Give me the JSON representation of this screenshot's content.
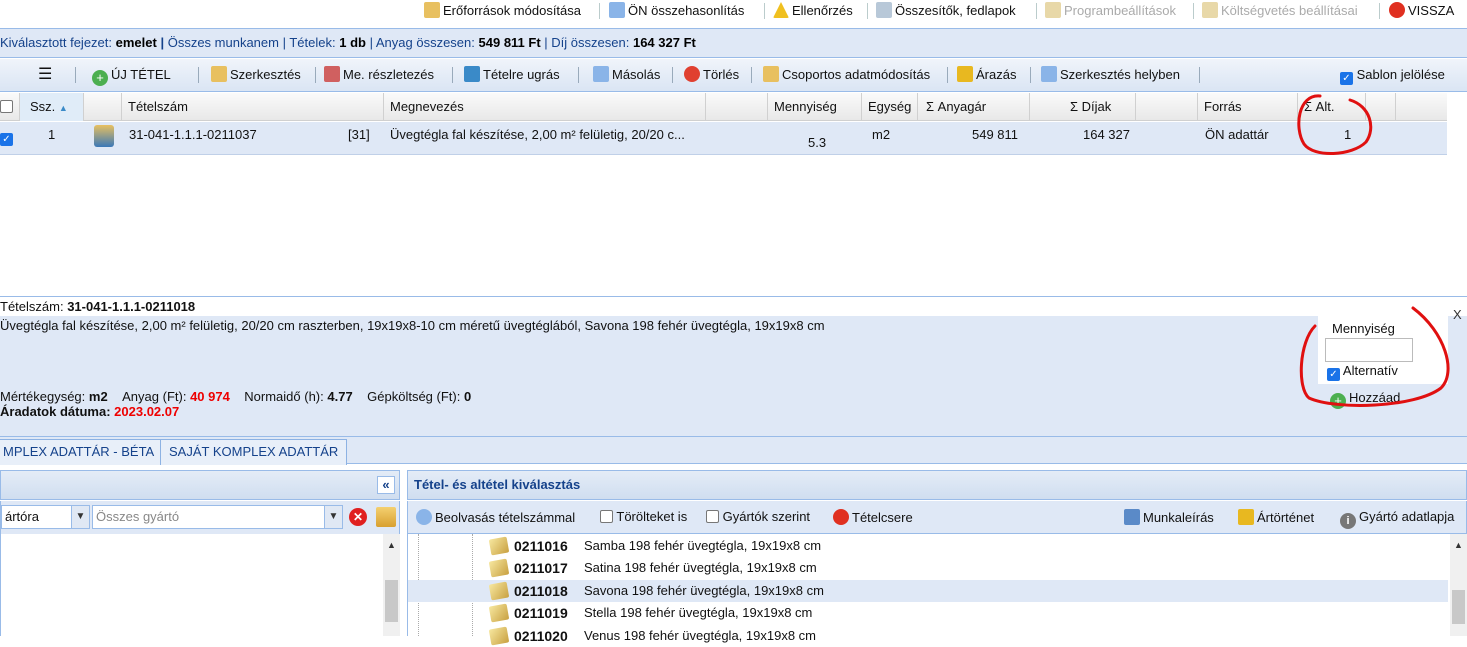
{
  "topbar": {
    "items": [
      "Erőforrások módosítása",
      "ÖN összehasonlítás",
      "Ellenőrzés",
      "Összesítők, fedlapok",
      "Programbeállítások",
      "Költségvetés beállításai",
      "VISSZA"
    ]
  },
  "info": {
    "chapter_label": "Kiválasztott fejezet:",
    "chapter_value": "emelet",
    "work_label": "Összes munkanem",
    "items_label": "Tételek:",
    "items_value": "1 db",
    "material_label": "Anyag összesen:",
    "material_value": "549 811 Ft",
    "fee_label": "Díj összesen:",
    "fee_value": "164 327 Ft"
  },
  "toolbar": {
    "new_item": "ÚJ TÉTEL",
    "edit": "Szerkesztés",
    "breakdown": "Me. részletezés",
    "jump": "Tételre ugrás",
    "copy": "Másolás",
    "delete": "Törlés",
    "group_edit": "Csoportos adatmódosítás",
    "pricing": "Árazás",
    "inplace_edit": "Szerkesztés helyben",
    "template_mark": "Sablon jelölése"
  },
  "grid": {
    "headers": [
      "Ssz.",
      "Tételszám",
      "Megnevezés",
      "Mennyiség",
      "Egység",
      "Σ Anyagár",
      "Σ Díjak",
      "Forrás",
      "Σ Alt."
    ],
    "row": {
      "ssz": "1",
      "code": "31-041-1.1.1-0211037",
      "tag": "[31]",
      "name": "Üvegtégla fal készítése, 2,00 m² felületig, 20/20 c...",
      "qty": "5.3",
      "unit": "m2",
      "material": "549 811",
      "fees": "164 327",
      "source": "ÖN adattár",
      "alt": "1"
    }
  },
  "detail": {
    "code_label": "Tételszám:",
    "code_value": "31-041-1.1.1-0211018",
    "close": "X",
    "description": "Üvegtégla fal készítése, 2,00 m² felületig, 20/20 cm raszterben, 19x19x8-10 cm méretű üvegtéglából, Savona 198 fehér üvegtégla, 19x19x8 cm",
    "unit_label": "Mértékegység:",
    "unit_value": "m2",
    "material_label": "Anyag (Ft):",
    "material_value": "40 974",
    "norm_label": "Normaidő (h):",
    "norm_value": "4.77",
    "machine_label": "Gépköltség (Ft):",
    "machine_value": "0",
    "date_label": "Áradatok dátuma:",
    "date_value": "2023.02.07",
    "qty_label": "Mennyiség",
    "alt_label": "Alternatív",
    "add_label": "Hozzáad"
  },
  "tabs": [
    "MPLEX ADATTÁR - BÉTA",
    "SAJÁT KOMPLEX ADATTÁR"
  ],
  "left": {
    "combo1": "ártóra",
    "combo2_placeholder": "Összes gyártó"
  },
  "right": {
    "title": "Tétel- és altétel kiválasztás",
    "scan": "Beolvasás tételszámmal",
    "deleted": "Törölteket is",
    "by_maker": "Gyártók szerint",
    "swap": "Tételcsere",
    "work_desc": "Munkaleírás",
    "price_hist": "Ártörténet",
    "maker_sheet": "Gyártó adatlapja",
    "items": [
      {
        "code": "0211016",
        "name": "Samba 198 fehér üvegtégla, 19x19x8 cm"
      },
      {
        "code": "0211017",
        "name": "Satina 198 fehér üvegtégla, 19x19x8 cm"
      },
      {
        "code": "0211018",
        "name": "Savona 198 fehér üvegtégla, 19x19x8 cm"
      },
      {
        "code": "0211019",
        "name": "Stella 198 fehér üvegtégla, 19x19x8 cm"
      },
      {
        "code": "0211020",
        "name": "Venus 198 fehér üvegtégla, 19x19x8 cm"
      }
    ]
  }
}
